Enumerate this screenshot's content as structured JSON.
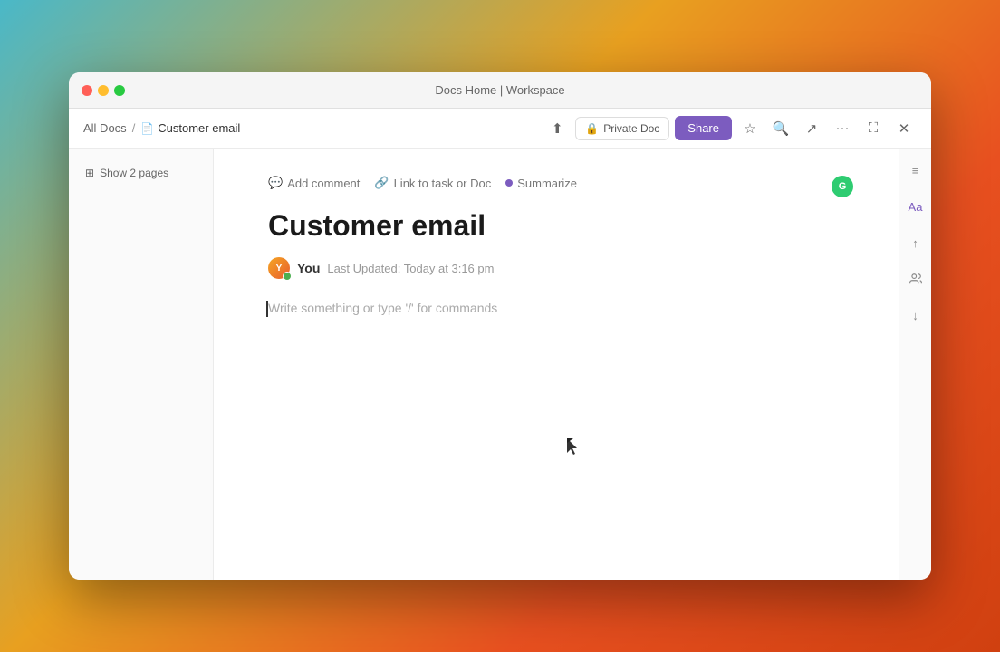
{
  "window": {
    "title": "Docs Home | Workspace"
  },
  "titlebar": {
    "title": "Docs Home | Workspace"
  },
  "breadcrumb": {
    "all_docs": "All Docs",
    "separator": "/",
    "current": "Customer email",
    "doc_icon": "📄"
  },
  "toolbar": {
    "private_doc_label": "Private Doc",
    "share_label": "Share"
  },
  "sidebar": {
    "show_pages_label": "Show 2 pages"
  },
  "doc_toolbar": {
    "add_comment": "Add comment",
    "link_task": "Link to task or Doc",
    "summarize": "Summarize"
  },
  "document": {
    "title": "Customer email",
    "author_name": "You",
    "last_updated": "Last Updated: Today at 3:16 pm",
    "editor_placeholder": "Write something or type '/' for commands"
  },
  "right_sidebar": {
    "icons": [
      "≡",
      "Aa",
      "↑",
      "👤",
      "↓"
    ]
  }
}
